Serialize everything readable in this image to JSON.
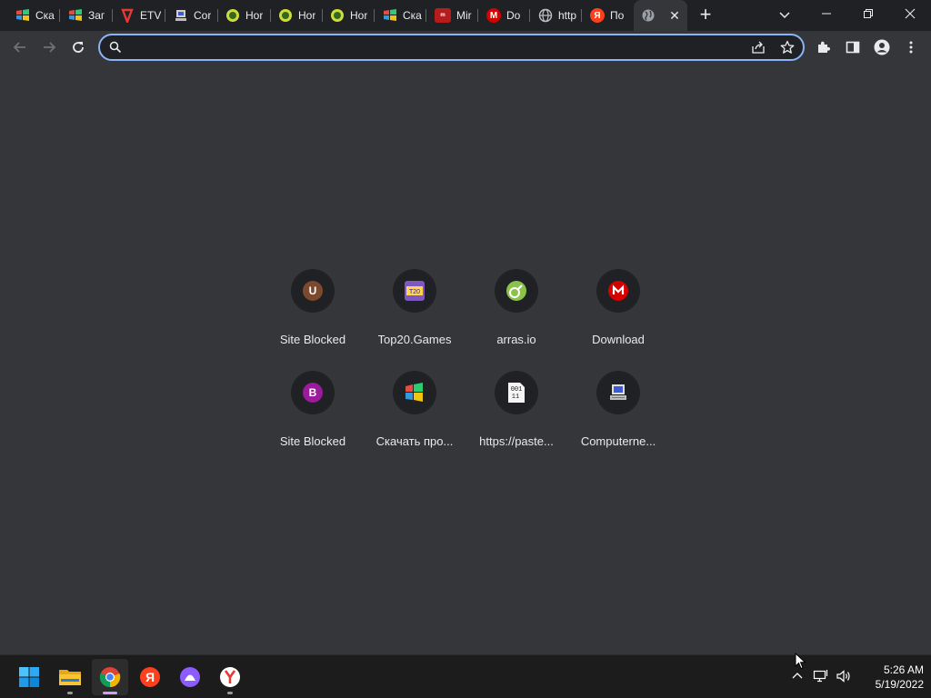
{
  "tabs": [
    {
      "title": "Ска",
      "icon": "windows-flag-icon"
    },
    {
      "title": "Заг",
      "icon": "windows-flag-icon"
    },
    {
      "title": "ETV",
      "icon": "etv-icon"
    },
    {
      "title": "Cor",
      "icon": "computer-icon"
    },
    {
      "title": "Hor",
      "icon": "game-icon"
    },
    {
      "title": "Hor",
      "icon": "game-icon"
    },
    {
      "title": "Hor",
      "icon": "game-icon"
    },
    {
      "title": "Ска",
      "icon": "windows-flag-icon"
    },
    {
      "title": "Mir",
      "icon": "mirror-icon"
    },
    {
      "title": "Do",
      "icon": "mega-icon"
    },
    {
      "title": "http",
      "icon": "globe-icon"
    },
    {
      "title": "По",
      "icon": "yandex-icon"
    },
    {
      "title": "",
      "icon": "globe-icon",
      "active": true
    }
  ],
  "omnibox": {
    "value": "",
    "placeholder": ""
  },
  "shortcuts": [
    {
      "label": "Site Blocked",
      "icon": "letter-u-icon",
      "letter": "U",
      "color": "#7b4a2e"
    },
    {
      "label": "Top20.Games",
      "icon": "top20-games-icon"
    },
    {
      "label": "arras.io",
      "icon": "arras-icon"
    },
    {
      "label": "Download",
      "icon": "mega-icon"
    },
    {
      "label": "Site Blocked",
      "icon": "letter-b-icon",
      "letter": "B",
      "color": "#9c1a9c"
    },
    {
      "label": "Скачать про...",
      "icon": "windows-flag-icon"
    },
    {
      "label": "https://paste...",
      "icon": "binary-doc-icon"
    },
    {
      "label": "Computerne...",
      "icon": "computer-icon"
    }
  ],
  "taskbar": {
    "apps": [
      {
        "name": "start-button",
        "icon": "windows-logo-icon"
      },
      {
        "name": "file-explorer",
        "icon": "folder-icon"
      },
      {
        "name": "chrome",
        "icon": "chrome-icon",
        "active": true
      },
      {
        "name": "yandex",
        "icon": "yandex-icon"
      },
      {
        "name": "alice",
        "icon": "alice-icon"
      },
      {
        "name": "yandex-browser",
        "icon": "yandex-browser-icon"
      }
    ],
    "clock": {
      "time": "5:26 AM",
      "date": "5/19/2022"
    }
  },
  "colors": {
    "accent": "#8ab4f8",
    "tab_strip": "#202124",
    "page_bg": "#35363a",
    "taskbar": "#1c1c1c"
  }
}
